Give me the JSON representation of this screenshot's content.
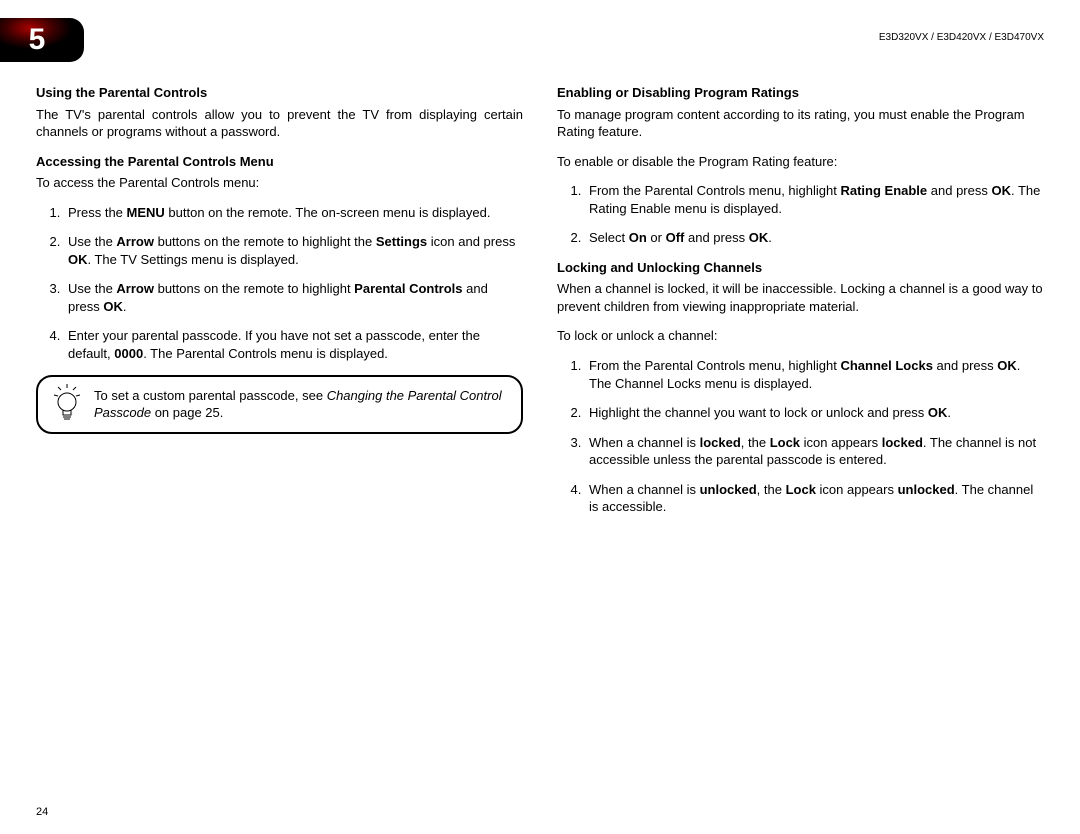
{
  "chapter_number": "5",
  "models": "E3D320VX / E3D420VX / E3D470VX",
  "page_number": "24",
  "left": {
    "h1": "Using the Parental Controls",
    "intro": "The TV's parental controls allow you to prevent the TV from displaying certain channels or programs without a password.",
    "h2": "Accessing the Parental Controls Menu",
    "lead": "To access the Parental Controls menu:",
    "steps": {
      "s1_a": "Press the ",
      "s1_b": "MENU",
      "s1_c": " button on the remote. The on-screen menu is displayed.",
      "s2_a": "Use the ",
      "s2_b": "Arrow",
      "s2_c": " buttons on the remote to highlight the ",
      "s2_d": "Settings",
      "s2_e": " icon and press ",
      "s2_f": "OK",
      "s2_g": ". The TV Settings menu is displayed.",
      "s3_a": "Use the ",
      "s3_b": "Arrow",
      "s3_c": " buttons on the remote to highlight ",
      "s3_d": "Parental Controls",
      "s3_e": " and press ",
      "s3_f": "OK",
      "s3_g": ".",
      "s4_a": "Enter your parental passcode. If you have not set a passcode, enter the default, ",
      "s4_b": "0000",
      "s4_c": ". The Parental Controls menu is displayed."
    },
    "tip_a": "To set a custom parental passcode, see ",
    "tip_i": "Changing the Parental Control Passcode",
    "tip_b": " on page 25."
  },
  "right": {
    "h1": "Enabling or Disabling Program Ratings",
    "intro": "To manage program content according to its rating, you must enable the Program Rating feature.",
    "lead": "To enable or disable the Program Rating feature:",
    "steps_a": {
      "s1_a": "From the Parental Controls menu, highlight ",
      "s1_b": "Rating Enable",
      "s1_c": " and press ",
      "s1_d": "OK",
      "s1_e": ". The Rating Enable menu is displayed.",
      "s2_a": "Select ",
      "s2_b": "On",
      "s2_c": " or ",
      "s2_d": "Off",
      "s2_e": " and press ",
      "s2_f": "OK",
      "s2_g": "."
    },
    "h2": "Locking and Unlocking Channels",
    "intro2": "When a channel is locked, it will be inaccessible. Locking a channel is a good way to prevent children from viewing inappropriate material.",
    "lead2": "To lock or unlock a channel:",
    "steps_b": {
      "s1_a": "From the Parental Controls menu, highlight ",
      "s1_b": "Channel Locks",
      "s1_c": " and press ",
      "s1_d": "OK",
      "s1_e": ". The Channel Locks menu is displayed.",
      "s2_a": "Highlight the channel you want to lock or unlock and press ",
      "s2_b": "OK",
      "s2_c": ".",
      "s3_a": "When a channel is ",
      "s3_b": "locked",
      "s3_c": ", the ",
      "s3_d": "Lock",
      "s3_e": " icon appears ",
      "s3_f": "locked",
      "s3_g": ". The channel is not accessible unless the parental passcode is entered.",
      "s4_a": "When a channel is ",
      "s4_b": "unlocked",
      "s4_c": ", the ",
      "s4_d": "Lock",
      "s4_e": " icon appears ",
      "s4_f": "unlocked",
      "s4_g": ". The channel is accessible."
    }
  }
}
